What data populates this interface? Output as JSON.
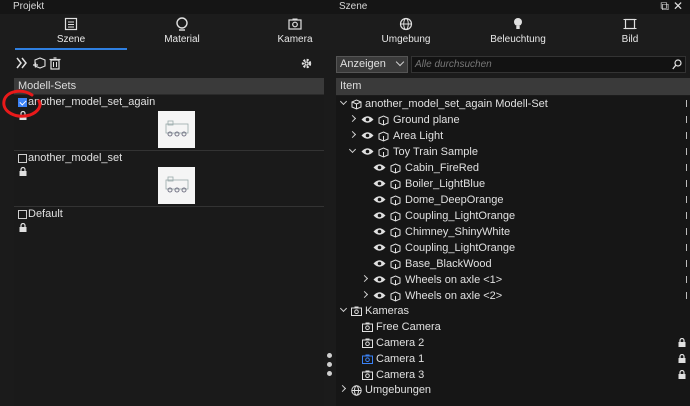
{
  "topbar": {
    "left_title": "Projekt",
    "center_title": "Szene",
    "window_icons": "⧉ ✕"
  },
  "tabs": [
    {
      "label": "Szene",
      "icon": "scene-grid-icon",
      "active": true
    },
    {
      "label": "Material",
      "icon": "material-icon"
    },
    {
      "label": "Kamera",
      "icon": "camera-icon"
    },
    {
      "label": "Umgebung",
      "icon": "globe-icon"
    },
    {
      "label": "Beleuchtung",
      "icon": "bulb-icon"
    },
    {
      "label": "Bild",
      "icon": "image-frame-icon"
    }
  ],
  "left_panel": {
    "header": "Modell-Sets",
    "model_sets": [
      {
        "name": "another_model_set_again",
        "checked": true,
        "has_thumb": true
      },
      {
        "name": "another_model_set",
        "checked": false,
        "has_thumb": true
      },
      {
        "name": "Default",
        "checked": false,
        "has_thumb": false
      }
    ]
  },
  "right_panel": {
    "dropdown_value": "Anzeigen",
    "search_placeholder": "Alle durchsuchen",
    "header": "Item",
    "tree": [
      {
        "label": "another_model_set_again Modell-Set"
      },
      {
        "label": "Ground plane"
      },
      {
        "label": "Area Light"
      },
      {
        "label": "Toy Train Sample"
      },
      {
        "label": "Cabin_FireRed"
      },
      {
        "label": "Boiler_LightBlue"
      },
      {
        "label": "Dome_DeepOrange"
      },
      {
        "label": "Coupling_LightOrange"
      },
      {
        "label": "Chimney_ShinyWhite"
      },
      {
        "label": "Coupling_LightOrange"
      },
      {
        "label": "Base_BlackWood"
      },
      {
        "label": "Wheels on axle <1>"
      },
      {
        "label": "Wheels on axle <2>"
      },
      {
        "label": "Kameras"
      },
      {
        "label": "Free Camera"
      },
      {
        "label": "Camera 2"
      },
      {
        "label": "Camera 1"
      },
      {
        "label": "Camera 3"
      },
      {
        "label": "Umgebungen"
      }
    ]
  },
  "colors": {
    "accent": "#2f7fe0",
    "annotation": "#e8191a",
    "active_camera": "#3b82f6"
  }
}
